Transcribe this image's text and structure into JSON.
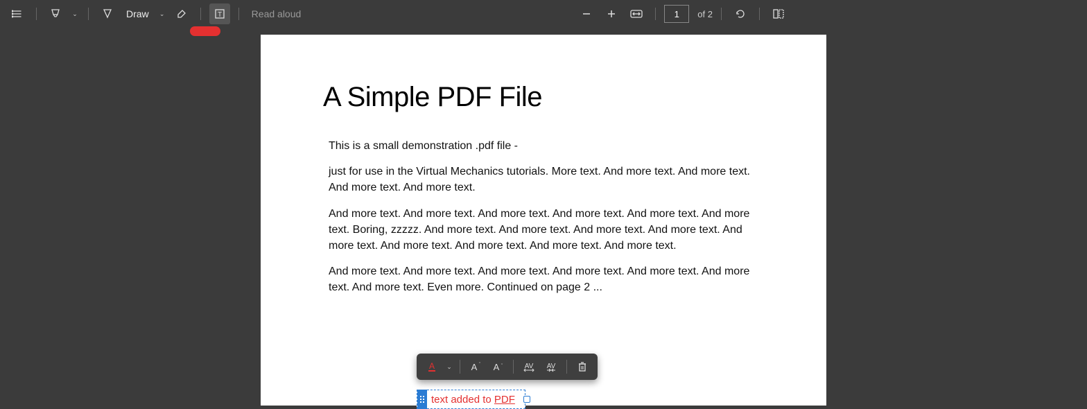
{
  "toolbar": {
    "draw_label": "Draw",
    "read_aloud_label": "Read aloud",
    "current_page": "1",
    "page_total_prefix": "of",
    "page_total": "2"
  },
  "document": {
    "title": "A Simple PDF File",
    "p1": "This is a small demonstration .pdf file -",
    "p2": "just for use in the Virtual Mechanics tutorials. More text. And more text. And more text. And more text. And more text.",
    "p3": "And more text. And more text. And more text. And more text. And more text. And more text. Boring, zzzzz. And more text. And more text. And more text. And more text. And more text. And more text. And more text. And more text. And more text.",
    "p4": "And more text. And more text. And more text. And more text. And more text. And more text. And more text. Even more. Continued on page 2 ..."
  },
  "annotation": {
    "text_prefix": "text added to ",
    "text_underlined": "PDF"
  },
  "colors": {
    "accent_red": "#e43030",
    "selection_blue": "#2b7cd3",
    "toolbar_bg": "#3b3b3b"
  }
}
